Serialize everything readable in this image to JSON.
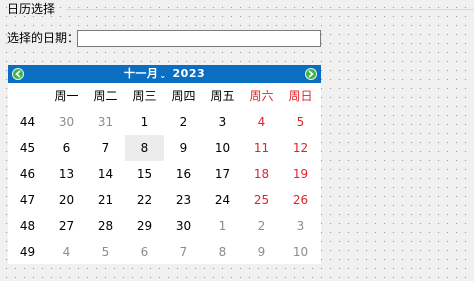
{
  "group": {
    "title": "日历选择"
  },
  "date_field": {
    "label": "选择的日期：",
    "value": ""
  },
  "calendar": {
    "month": "十一月",
    "year": "2023",
    "prev_icon": "left-arrow-icon",
    "next_icon": "right-arrow-icon",
    "weekdays": [
      "周一",
      "周二",
      "周三",
      "周四",
      "周五",
      "周六",
      "周日"
    ],
    "weeks": [
      {
        "num": "44",
        "days": [
          "30",
          "31",
          "1",
          "2",
          "3",
          "4",
          "5"
        ]
      },
      {
        "num": "45",
        "days": [
          "6",
          "7",
          "8",
          "9",
          "10",
          "11",
          "12"
        ]
      },
      {
        "num": "46",
        "days": [
          "13",
          "14",
          "15",
          "16",
          "17",
          "18",
          "19"
        ]
      },
      {
        "num": "47",
        "days": [
          "20",
          "21",
          "22",
          "23",
          "24",
          "25",
          "26"
        ]
      },
      {
        "num": "48",
        "days": [
          "27",
          "28",
          "29",
          "30",
          "1",
          "2",
          "3"
        ]
      },
      {
        "num": "49",
        "days": [
          "4",
          "5",
          "6",
          "7",
          "8",
          "9",
          "10"
        ]
      }
    ],
    "colors": {
      "header": "#0a6fc2",
      "weekend": "#e1232b",
      "other_month": "#8c8c8c",
      "selected_bg": "#ececec"
    }
  }
}
